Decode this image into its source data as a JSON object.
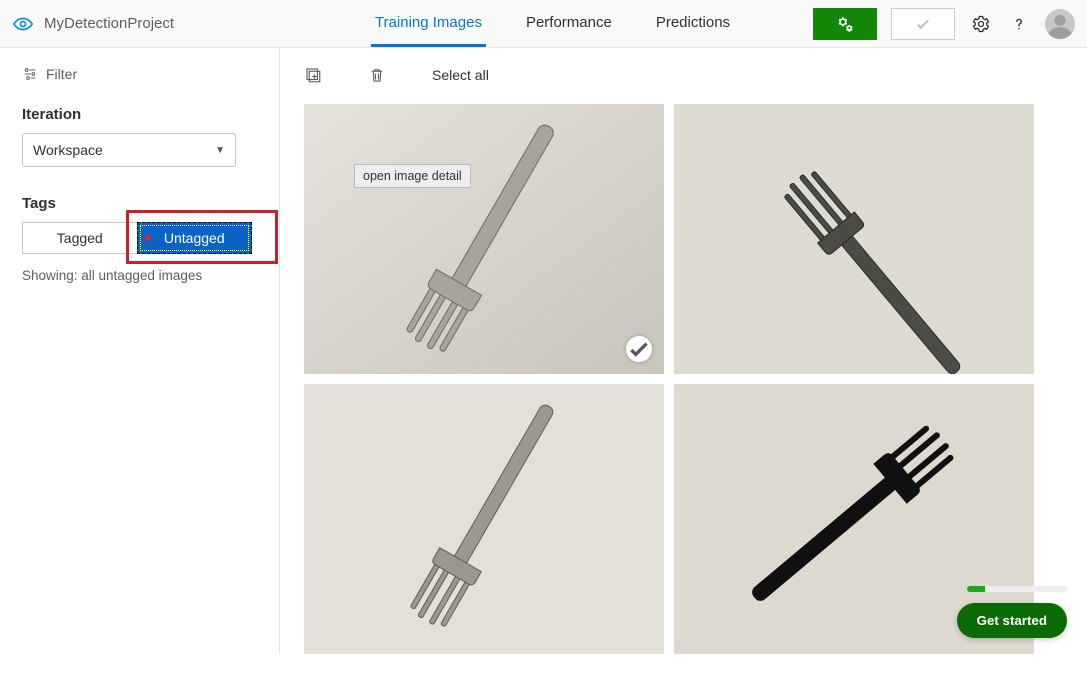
{
  "header": {
    "project_name": "MyDetectionProject",
    "tabs": [
      {
        "label": "Training Images",
        "active": true
      },
      {
        "label": "Performance",
        "active": false
      },
      {
        "label": "Predictions",
        "active": false
      }
    ]
  },
  "sidebar": {
    "filter_label": "Filter",
    "iteration_title": "Iteration",
    "iteration_value": "Workspace",
    "tags_title": "Tags",
    "tag_tagged_label": "Tagged",
    "tag_untagged_label": "Untagged",
    "showing_text": "Showing: all untagged images"
  },
  "toolbar": {
    "select_all_label": "Select all"
  },
  "image_detail_tooltip": "open image detail",
  "getstarted_label": "Get started",
  "progress_percent": 18
}
